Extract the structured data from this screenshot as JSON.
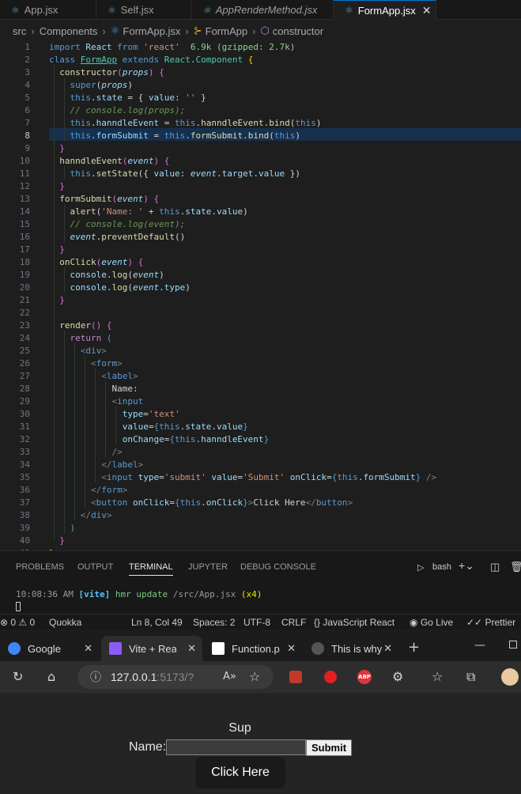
{
  "editor_tabs": [
    {
      "label": "App.jsx",
      "active": false
    },
    {
      "label": "Self.jsx",
      "active": false
    },
    {
      "label": "AppRenderMethod.jsx",
      "active": false,
      "italic": true
    },
    {
      "label": "FormApp.jsx",
      "active": true
    }
  ],
  "breadcrumb": {
    "items": [
      "src",
      "Components",
      "FormApp.jsx",
      "FormApp",
      "constructor"
    ]
  },
  "editor": {
    "current_line": 8
  },
  "panel": {
    "tabs": [
      "PROBLEMS",
      "OUTPUT",
      "TERMINAL",
      "JUPYTER",
      "DEBUG CONSOLE"
    ],
    "active_tab": "TERMINAL",
    "shell": "bash",
    "terminal": {
      "time": "10:08:36 AM",
      "tag": "[vite]",
      "msg": " hmr update ",
      "path": "/src/App.jsx",
      "count": "(x4)"
    }
  },
  "status": {
    "errors": "0",
    "warnings": "0",
    "quokka": "Quokka",
    "position": "Ln 8, Col 49",
    "spaces": "Spaces: 2",
    "encoding": "UTF-8",
    "eol": "CRLF",
    "language": "JavaScript React",
    "golive": "Go Live",
    "prettier": "Prettier"
  },
  "browser": {
    "tabs": [
      {
        "label": "Google",
        "color": "#4285f4"
      },
      {
        "label": "Vite + React",
        "color": "#8b5cf6"
      },
      {
        "label": "Function.p",
        "color": "#ffffff"
      },
      {
        "label": "This is why",
        "color": "#333333"
      }
    ],
    "url_host": "127.0.0.1",
    "url_rest": ":5173/?"
  },
  "app": {
    "heading": "Sup",
    "label": "Name:",
    "input_value": "",
    "submit_label": "Submit",
    "click_label": "Click Here"
  }
}
